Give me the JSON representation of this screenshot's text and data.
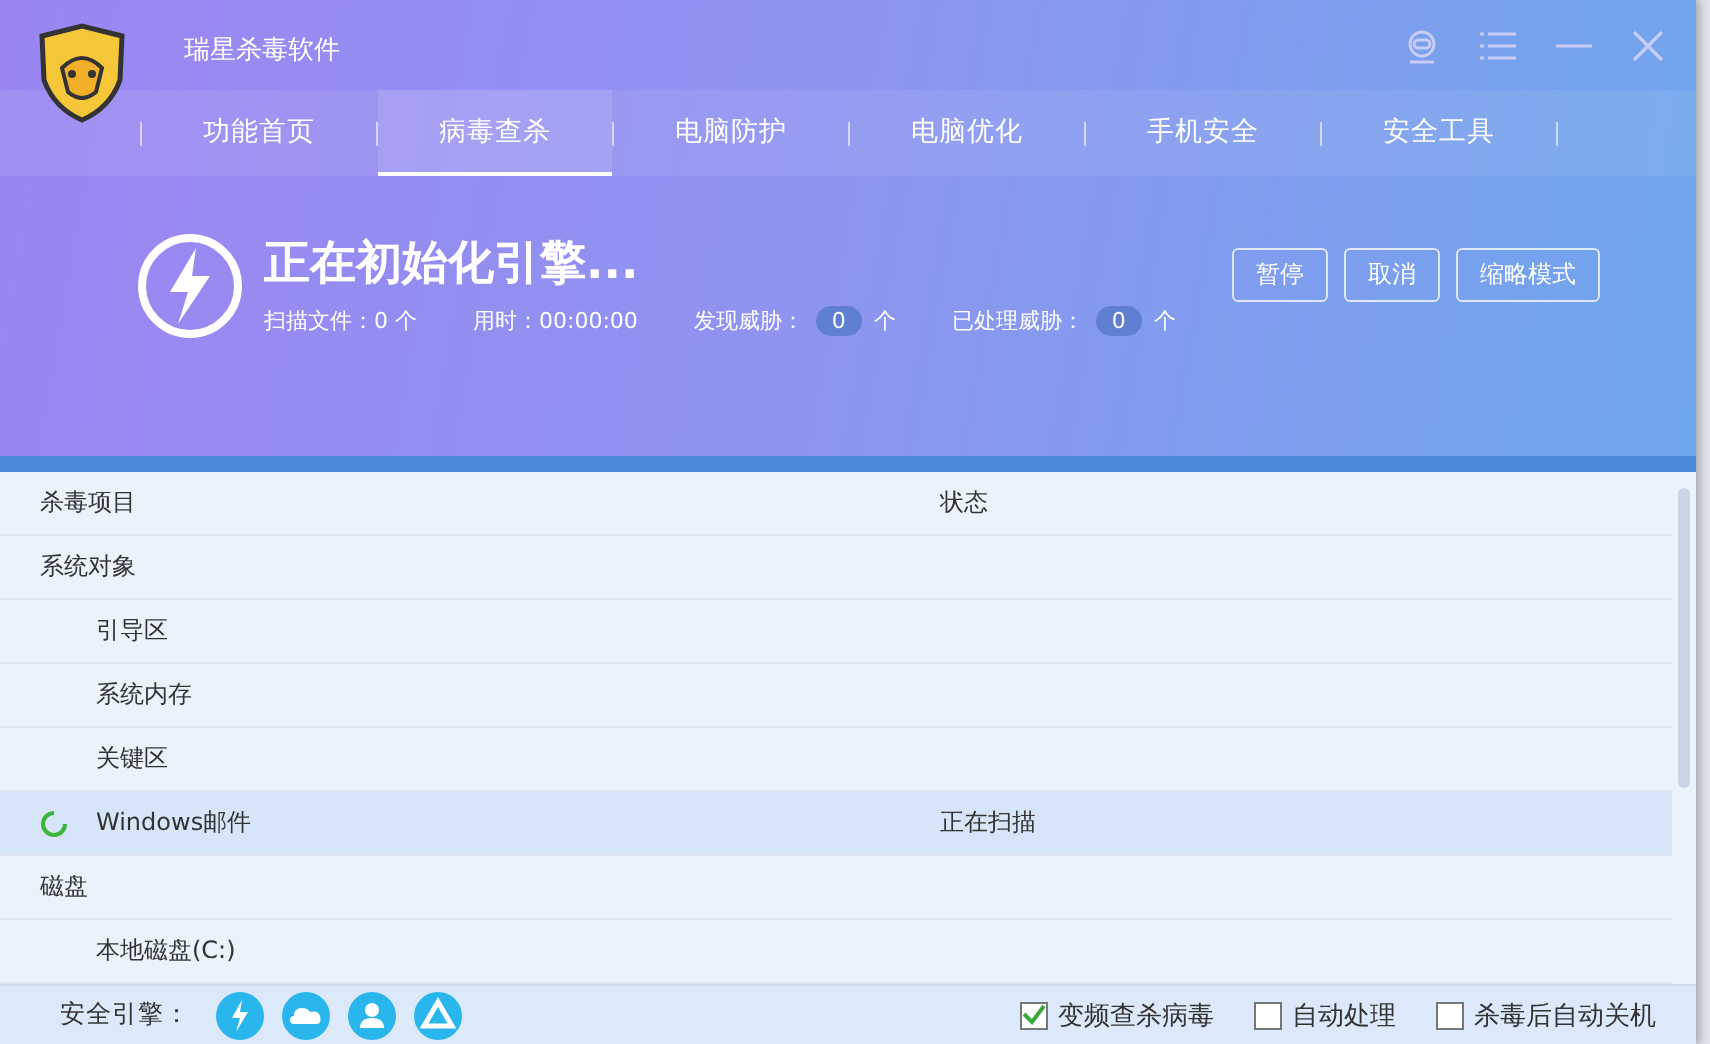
{
  "window": {
    "title": "瑞星杀毒软件"
  },
  "tabs": [
    {
      "label": "功能首页",
      "selected": false
    },
    {
      "label": "病毒查杀",
      "selected": true
    },
    {
      "label": "电脑防护",
      "selected": false
    },
    {
      "label": "电脑优化",
      "selected": false
    },
    {
      "label": "手机安全",
      "selected": false
    },
    {
      "label": "安全工具",
      "selected": false
    }
  ],
  "scan": {
    "title": "正在初始化引擎...",
    "files_label": "扫描文件：0 个",
    "time_label": "用时：00:00:00",
    "threats_label": "发现威胁：",
    "threats": "0",
    "threats_unit": "个",
    "handled_label": "已处理威胁：",
    "handled": "0",
    "handled_unit": "个",
    "buttons": [
      "暂停",
      "取消",
      "缩略模式"
    ]
  },
  "table": {
    "columns": [
      "杀毒项目",
      "状态"
    ],
    "rows": [
      {
        "name": "系统对象",
        "selected": false,
        "scanning": false,
        "children": [
          {
            "name": "引导区",
            "selected": false,
            "scanning": false
          },
          {
            "name": "系统内存",
            "selected": false,
            "scanning": false
          },
          {
            "name": "关键区",
            "selected": false,
            "scanning": false
          },
          {
            "name": "Windows邮件",
            "selected": true,
            "scanning": true,
            "status": "正在扫描"
          }
        ]
      },
      {
        "name": "磁盘",
        "selected": false,
        "scanning": false,
        "children": [
          {
            "name": "本地磁盘(C:)",
            "selected": false,
            "scanning": false
          }
        ]
      }
    ]
  },
  "footer": {
    "engines_label": "安全引擎：",
    "options": [
      {
        "label": "变频查杀病毒",
        "checked": true
      },
      {
        "label": "自动处理",
        "checked": false
      },
      {
        "label": "杀毒后自动关机",
        "checked": false
      }
    ]
  }
}
